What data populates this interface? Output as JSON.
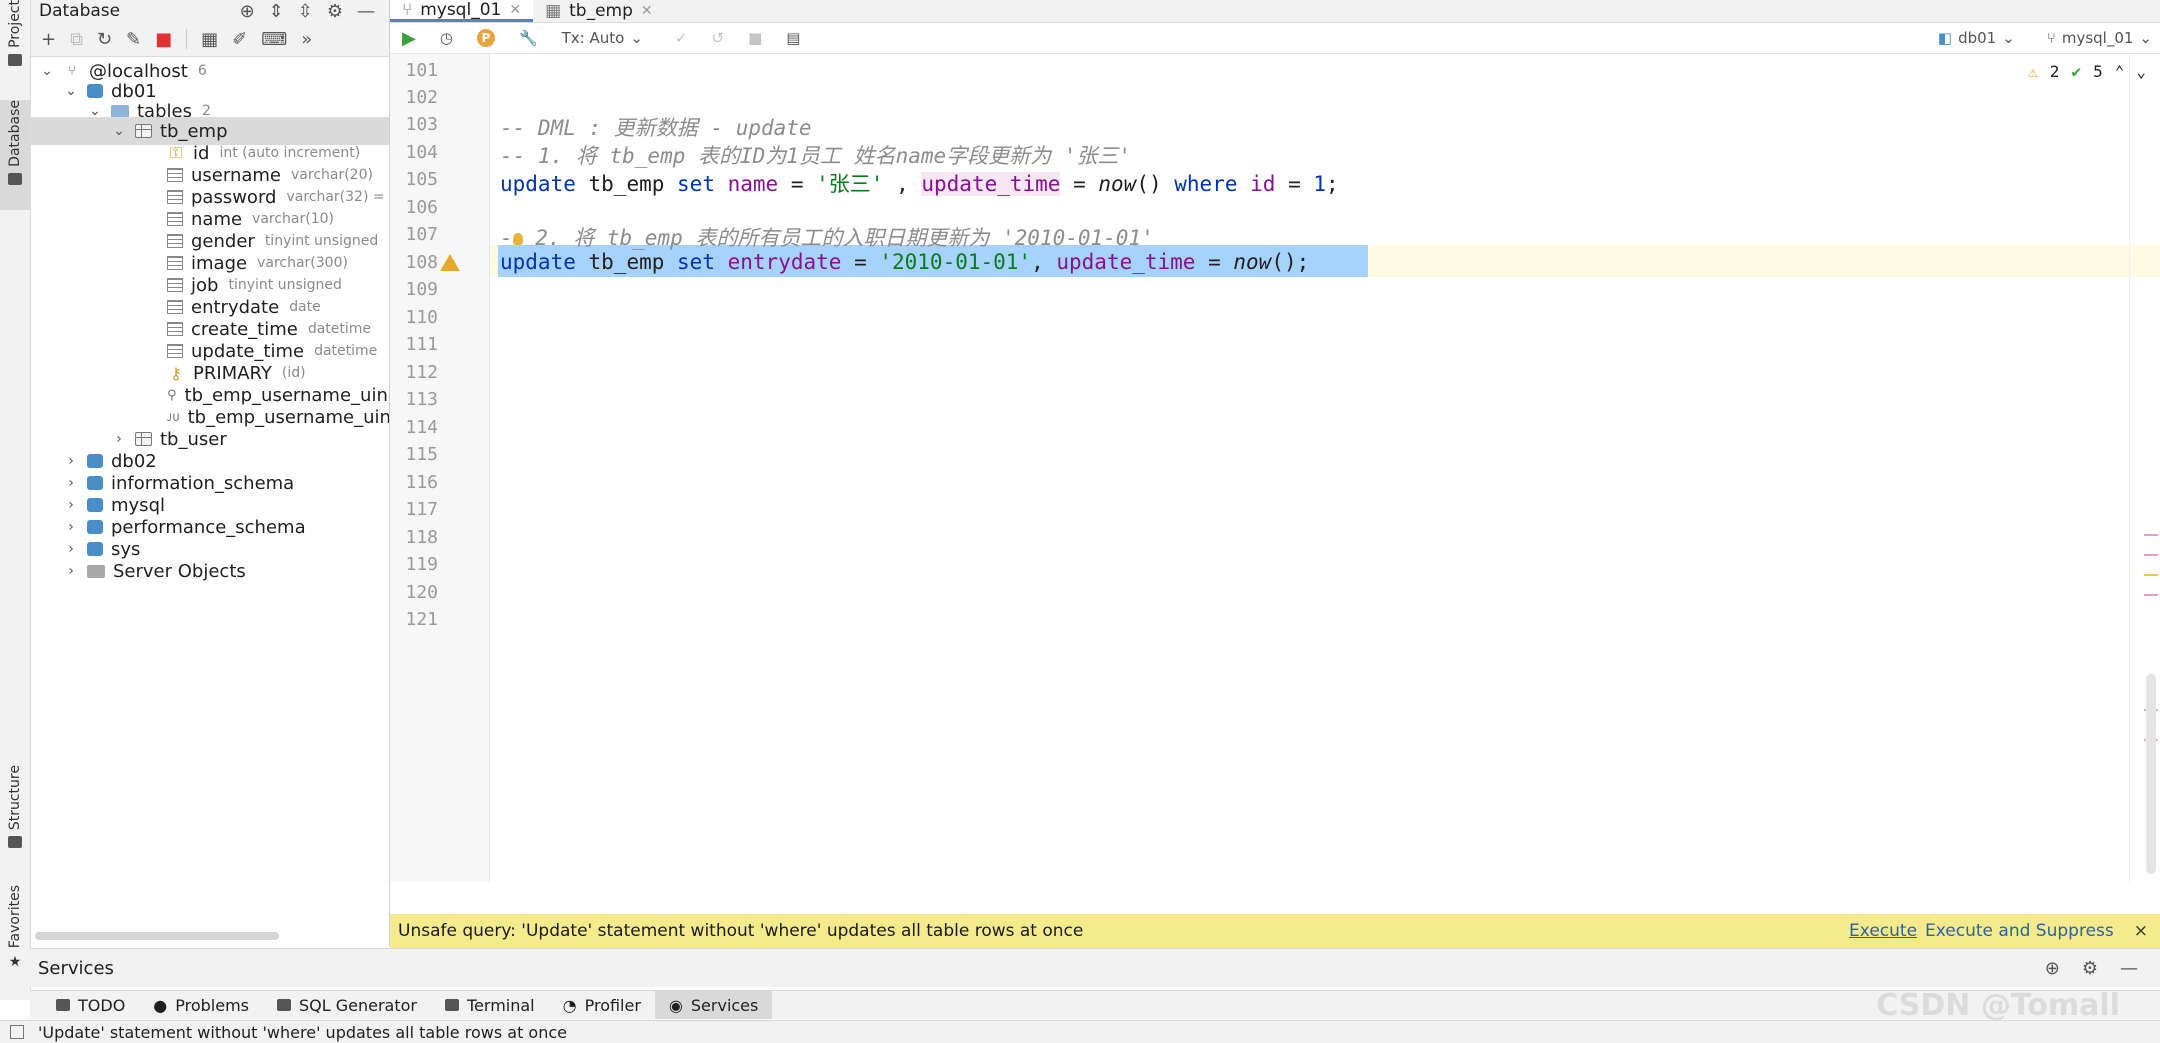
{
  "left_strip": {
    "project": "Project",
    "database": "Database",
    "structure": "Structure",
    "favorites": "Favorites"
  },
  "db_panel": {
    "title": "Database",
    "tree": [
      {
        "name": "@localhost",
        "type": "6"
      },
      {
        "name": "db01",
        "type": ""
      },
      {
        "name": "tables",
        "type": "2"
      },
      {
        "name": "tb_emp",
        "type": ""
      },
      {
        "name": "id",
        "type": "int (auto increment)"
      },
      {
        "name": "username",
        "type": "varchar(20)"
      },
      {
        "name": "password",
        "type": "varchar(32) ="
      },
      {
        "name": "name",
        "type": "varchar(10)"
      },
      {
        "name": "gender",
        "type": "tinyint unsigned"
      },
      {
        "name": "image",
        "type": "varchar(300)"
      },
      {
        "name": "job",
        "type": "tinyint unsigned"
      },
      {
        "name": "entrydate",
        "type": "date"
      },
      {
        "name": "create_time",
        "type": "datetime"
      },
      {
        "name": "update_time",
        "type": "datetime"
      },
      {
        "name": "PRIMARY",
        "type": "(id)"
      },
      {
        "name": "tb_emp_username_uind",
        "type": ""
      },
      {
        "name": "tb_emp_username_uind",
        "type": ""
      },
      {
        "name": "tb_user",
        "type": ""
      },
      {
        "name": "db02",
        "type": ""
      },
      {
        "name": "information_schema",
        "type": ""
      },
      {
        "name": "mysql",
        "type": ""
      },
      {
        "name": "performance_schema",
        "type": ""
      },
      {
        "name": "sys",
        "type": ""
      },
      {
        "name": "Server Objects",
        "type": ""
      }
    ]
  },
  "tabs": [
    {
      "label": "mysql_01"
    },
    {
      "label": "tb_emp"
    }
  ],
  "toolbar": {
    "tx_mode": "Tx: Auto",
    "schema": "db01",
    "datasource": "mysql_01",
    "p_badge": "P"
  },
  "inspections": {
    "warnings": "2",
    "ok": "5"
  },
  "lines": [
    "101",
    "102",
    "103",
    "104",
    "105",
    "106",
    "107",
    "108",
    "109",
    "110",
    "111",
    "112",
    "113",
    "114",
    "115",
    "116",
    "117",
    "118",
    "119",
    "120",
    "121"
  ],
  "code": {
    "l103": "-- DML : 更新数据 - update",
    "l104": "-- 1. 将 tb_emp 表的ID为1员工 姓名name字段更新为 '张三'",
    "l107": " 2. 将 tb_emp 表的所有员工的入职日期更新为 '2010-01-01'",
    "l107_dash": "-",
    "kw_update": "update",
    "kw_set": "set",
    "kw_where": "where",
    "tbl": "tb_emp",
    "col_name": "name",
    "col_update_time": "update_time",
    "col_id": "id",
    "col_entrydate": "entrydate",
    "str_zhangsan": "'张三'",
    "str_date": "'2010-01-01'",
    "fn_now": "now",
    "num_1": "1"
  },
  "banner": {
    "message": "Unsafe query: 'Update' statement without 'where' updates all table rows at once",
    "execute": "Execute",
    "execute_suppress": "Execute and Suppress",
    "close": "×"
  },
  "services": {
    "title": "Services"
  },
  "bottom_tabs": [
    {
      "label": "TODO"
    },
    {
      "label": "Problems"
    },
    {
      "label": "SQL Generator"
    },
    {
      "label": "Terminal"
    },
    {
      "label": "Profiler"
    },
    {
      "label": "Services"
    }
  ],
  "status": {
    "message": "'Update' statement without 'where' updates all table rows at once"
  },
  "watermark": "CSDN @Tomall"
}
